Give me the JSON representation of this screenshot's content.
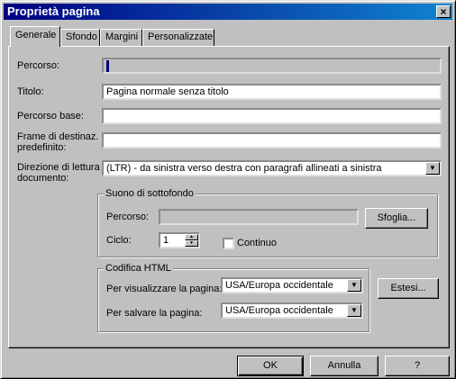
{
  "window": {
    "title": "Proprietà pagina",
    "close_label": "×"
  },
  "tabs": [
    {
      "label": "Generale"
    },
    {
      "label": "Sfondo"
    },
    {
      "label": "Margini"
    },
    {
      "label": "Personalizzate"
    }
  ],
  "general": {
    "percorso": {
      "label": "Percorso:",
      "value": ""
    },
    "titolo": {
      "label": "Titolo:",
      "value": "Pagina normale senza titolo"
    },
    "percorso_base": {
      "label": "Percorso base:",
      "value": ""
    },
    "frame": {
      "label_line1": "Frame di destinaz.",
      "label_line2": "predefinito:",
      "value": ""
    },
    "direzione": {
      "label_line1": "Direzione di lettura",
      "label_line2": "documento:",
      "value": "(LTR) - da sinistra verso destra con paragrafi allineati a sinistra"
    }
  },
  "sound": {
    "group_title": "Suono di sottofondo",
    "percorso_label": "Percorso:",
    "percorso_value": "",
    "browse_label": "Sfoglia...",
    "ciclo_label": "Ciclo:",
    "ciclo_value": "1",
    "continuo_label": "Continuo",
    "continuo_checked": false
  },
  "encoding": {
    "group_title": "Codifica HTML",
    "view_label": "Per visualizzare la pagina:",
    "view_value": "USA/Europa occidentale",
    "save_label": "Per salvare la pagina:",
    "save_value": "USA/Europa occidentale",
    "extended_label": "Estesi..."
  },
  "footer": {
    "ok_label": "OK",
    "cancel_label": "Annulla",
    "help_label": "?"
  }
}
